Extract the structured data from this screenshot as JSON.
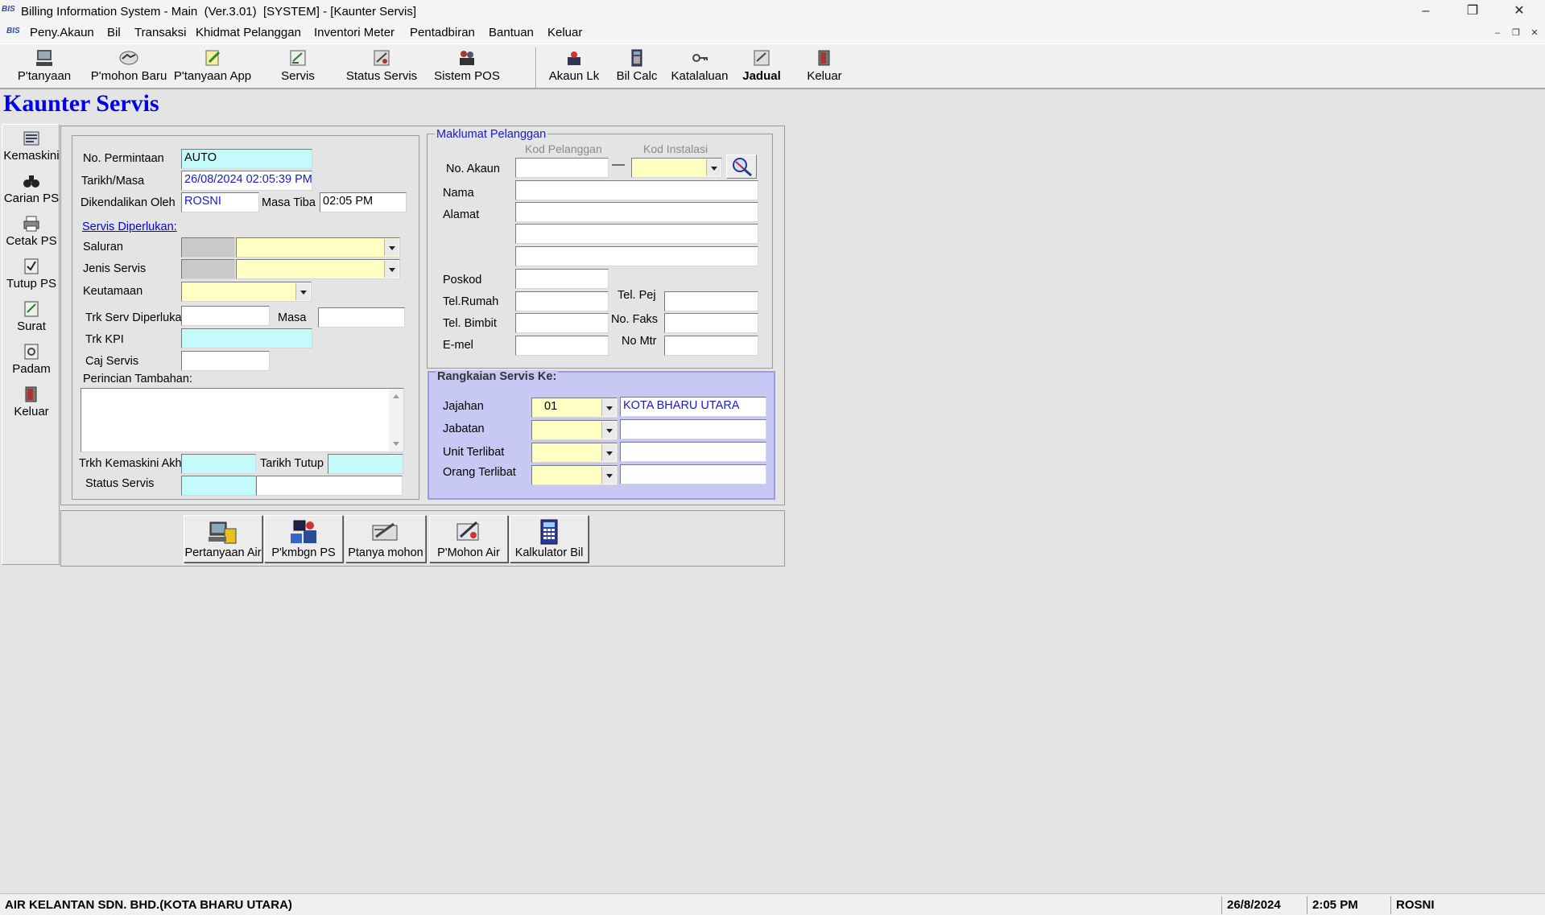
{
  "window": {
    "title": "Billing Information System - Main  (Ver.3.01)  [SYSTEM] - [Kaunter Servis]",
    "app_icon_text": "BIS",
    "buttons": [
      "minimize-icon",
      "restore-icon",
      "close-icon"
    ]
  },
  "menu": {
    "items": [
      "Peny.Akaun",
      "Bil",
      "Transaksi",
      "Khidmat Pelanggan",
      "Inventori Meter",
      "Pentadbiran",
      "Bantuan",
      "Keluar"
    ]
  },
  "toolbar": {
    "items": [
      {
        "label": "P'tanyaan",
        "icon": "computer-icon"
      },
      {
        "label": "P'mohon Baru",
        "icon": "handshake-icon"
      },
      {
        "label": "P'tanyaan App",
        "icon": "document-pencil-icon"
      },
      {
        "label": "Servis",
        "icon": "service-form-icon"
      },
      {
        "label": "Status Servis",
        "icon": "status-icon"
      },
      {
        "label": "Sistem POS",
        "icon": "people-icon"
      },
      {
        "label": "Akaun Lk",
        "icon": "account-icon"
      },
      {
        "label": "Bil Calc",
        "icon": "calculator-icon"
      },
      {
        "label": "Katalaluan",
        "icon": "key-icon"
      },
      {
        "label": "Jadual",
        "icon": "schedule-icon"
      },
      {
        "label": "Keluar",
        "icon": "exit-door-icon"
      }
    ]
  },
  "form": {
    "title": "Kaunter Servis"
  },
  "left_toolbar": {
    "items": [
      {
        "label": "Kemaskini",
        "icon": "edit-icon"
      },
      {
        "label": "Carian PS",
        "icon": "binoculars-icon"
      },
      {
        "label": "Cetak PS",
        "icon": "printer-icon"
      },
      {
        "label": "Tutup PS",
        "icon": "checkmark-doc-icon"
      },
      {
        "label": "Surat",
        "icon": "letter-icon"
      },
      {
        "label": "Padam",
        "icon": "delete-doc-icon"
      },
      {
        "label": "Keluar",
        "icon": "exit-door-icon"
      }
    ]
  },
  "request": {
    "no_permintaan_label": "No. Permintaan",
    "no_permintaan_value": "AUTO",
    "tarikh_masa_label": "Tarikh/Masa",
    "tarikh_masa_value": "26/08/2024 02:05:39 PM",
    "dikendalikan_label": "Dikendalikan Oleh",
    "dikendalikan_value": "ROSNI",
    "masa_tiba_label": "Masa Tiba",
    "masa_tiba_value": "02:05 PM",
    "servis_diperlukan_link": "Servis Diperlukan:",
    "saluran_label": "Saluran",
    "jenis_servis_label": "Jenis Servis",
    "keutamaan_label": "Keutamaan",
    "trk_serv_label": "Trk Serv Diperlukan",
    "masa_label": "Masa",
    "trk_kpi_label": "Trk KPI",
    "caj_servis_label": "Caj Servis",
    "perincian_label": "Perincian Tambahan:",
    "trkh_kemaskini_label": "Trkh Kemaskini Akhir",
    "tarikh_tutup_label": "Tarikh Tutup",
    "status_servis_label": "Status Servis"
  },
  "customer": {
    "legend": "Maklumat Pelanggan",
    "kod_pelanggan_header": "Kod Pelanggan",
    "kod_instalasi_header": "Kod Instalasi",
    "no_akaun_label": "No. Akaun",
    "nama_label": "Nama",
    "alamat_label": "Alamat",
    "poskod_label": "Poskod",
    "tel_rumah_label": "Tel.Rumah",
    "tel_pej_label": "Tel. Pej",
    "tel_bimbit_label": "Tel. Bimbit",
    "no_faks_label": "No. Faks",
    "emel_label": "E-mel",
    "no_mtr_label": "No Mtr"
  },
  "rangkaian": {
    "legend": "Rangkaian Servis Ke:",
    "jajahan_label": "Jajahan",
    "jajahan_code": "01",
    "jajahan_name": "KOTA BHARU UTARA",
    "jabatan_label": "Jabatan",
    "unit_label": "Unit Terlibat",
    "orang_label": "Orang Terlibat"
  },
  "actions": {
    "items": [
      {
        "label": "Pertanyaan Air",
        "icon": "water-inquiry-icon"
      },
      {
        "label": "P'kmbgn PS",
        "icon": "ps-development-icon"
      },
      {
        "label": "Ptanya mohon",
        "icon": "application-inquiry-icon"
      },
      {
        "label": "P'Mohon Air",
        "icon": "water-application-icon"
      },
      {
        "label": "Kalkulator Bil",
        "icon": "calculator-icon"
      }
    ]
  },
  "status_bar": {
    "company": "AIR KELANTAN SDN. BHD.(KOTA BHARU UTARA)",
    "date": "26/8/2024",
    "time": "2:05 PM",
    "user": "ROSNI"
  },
  "colors": {
    "title_blue": "#0000ee",
    "input_cyan": "#c5fafc",
    "input_yellow": "#ffffc4",
    "panel_lavender": "#c8c8f4"
  }
}
